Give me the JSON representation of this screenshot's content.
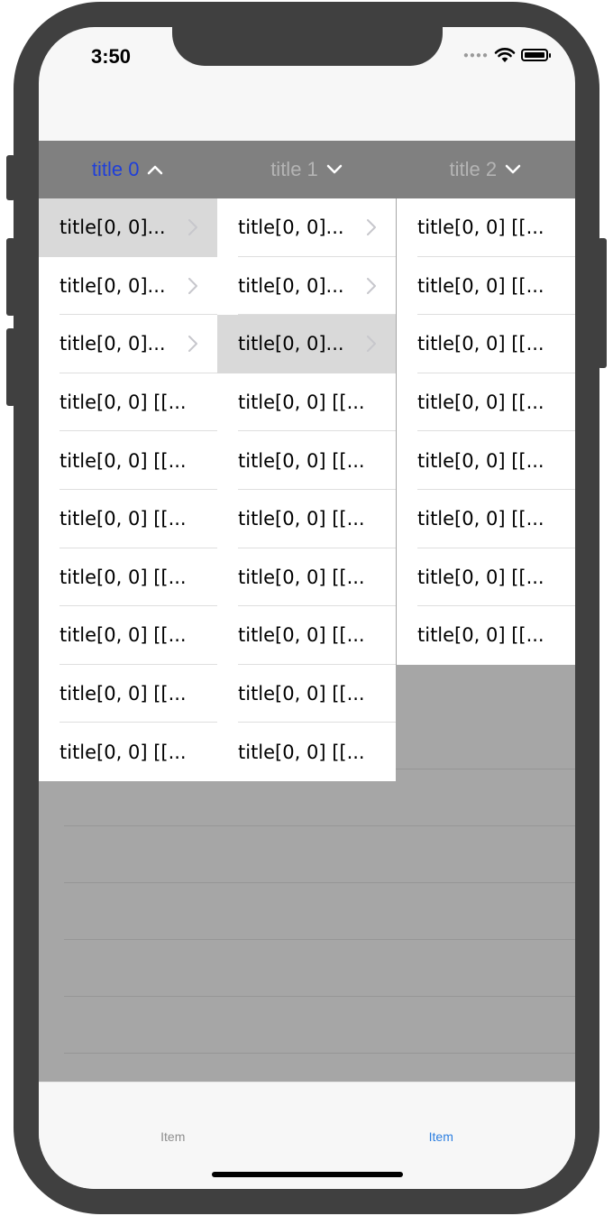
{
  "status_bar": {
    "time": "3:50",
    "icons": [
      "signal-icon",
      "wifi-icon",
      "battery-icon"
    ]
  },
  "menu": {
    "tabs": [
      {
        "label": "title 0",
        "state": "open",
        "icon": "chevron-up-icon"
      },
      {
        "label": "title 1",
        "state": "closed",
        "icon": "chevron-down-icon"
      },
      {
        "label": "title 2",
        "state": "closed",
        "icon": "chevron-down-icon"
      }
    ]
  },
  "columns": [
    {
      "rows": [
        {
          "label": "title[0, 0]...",
          "disclosure": true,
          "selected": true
        },
        {
          "label": "title[0, 0]...",
          "disclosure": true
        },
        {
          "label": "title[0, 0]...",
          "disclosure": true
        },
        {
          "label": "title[0, 0] [[..."
        },
        {
          "label": "title[0, 0] [[..."
        },
        {
          "label": "title[0, 0] [[..."
        },
        {
          "label": "title[0, 0] [[..."
        },
        {
          "label": "title[0, 0] [[..."
        },
        {
          "label": "title[0, 0] [[..."
        },
        {
          "label": "title[0, 0] [[..."
        }
      ]
    },
    {
      "rows": [
        {
          "label": "title[0, 0]...",
          "disclosure": true
        },
        {
          "label": "title[0, 0]...",
          "disclosure": true
        },
        {
          "label": "title[0, 0]...",
          "disclosure": true,
          "selected": true
        },
        {
          "label": "title[0, 0] [[..."
        },
        {
          "label": "title[0, 0] [[..."
        },
        {
          "label": "title[0, 0] [[..."
        },
        {
          "label": "title[0, 0] [[..."
        },
        {
          "label": "title[0, 0] [[..."
        },
        {
          "label": "title[0, 0] [[..."
        },
        {
          "label": "title[0, 0] [[..."
        }
      ]
    },
    {
      "rows": [
        {
          "label": "title[0, 0] [[..."
        },
        {
          "label": "title[0, 0] [[..."
        },
        {
          "label": "title[0, 0] [[..."
        },
        {
          "label": "title[0, 0] [[..."
        },
        {
          "label": "title[0, 0] [[..."
        },
        {
          "label": "title[0, 0] [[..."
        },
        {
          "label": "title[0, 0] [[..."
        },
        {
          "label": "title[0, 0] [[..."
        }
      ]
    }
  ],
  "tab_bar": {
    "items": [
      {
        "label": "Item",
        "active": false
      },
      {
        "label": "Item",
        "active": true
      }
    ]
  },
  "colors": {
    "active_menu": "#1f3fd9",
    "inactive_menu": "#b4b4b4",
    "menu_bar_bg": "#808080",
    "overlay_bg": "#a6a6a6",
    "selected_row": "#d9d9d9",
    "tab_active": "#2d7fe0",
    "tab_inactive": "#8e8e8e"
  }
}
